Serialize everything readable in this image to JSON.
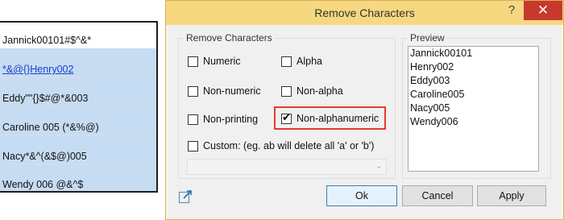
{
  "sheet": {
    "cells": [
      "Jannick00101#$^&*",
      "*&@{}Henry002",
      "Eddy\"\"{}$#@*&003",
      "Caroline 005 (*&%@)",
      " Nacy*&^(&$@)005",
      "Wendy 006 @&^$"
    ]
  },
  "dialog": {
    "title": "Remove Characters",
    "help": "?",
    "close": "✕",
    "options_group_label": "Remove Characters",
    "options": {
      "numeric": "Numeric",
      "alpha": "Alpha",
      "non_numeric": "Non-numeric",
      "non_alpha": "Non-alpha",
      "non_printing": "Non-printing",
      "non_alphanumeric": "Non-alphanumeric",
      "custom": "Custom: (eg. ab will delete all 'a' or 'b')"
    },
    "checked_option": "non_alphanumeric",
    "custom_value": "",
    "preview_label": "Preview",
    "preview_lines": [
      "Jannick00101",
      "Henry002",
      "Eddy003",
      "Caroline005",
      "Nacy005",
      "Wendy006"
    ],
    "buttons": {
      "ok": "Ok",
      "cancel": "Cancel",
      "apply": "Apply"
    }
  },
  "colors": {
    "title_bar": "#f6d880",
    "close": "#c8392d",
    "selection": "#c6dcf3",
    "highlight": "#e53935",
    "link": "#1a3fcc"
  },
  "icons": {
    "expand": "expand-arrow-icon",
    "help": "help-icon",
    "close": "close-icon",
    "dropdown": "chevron-down-icon"
  }
}
